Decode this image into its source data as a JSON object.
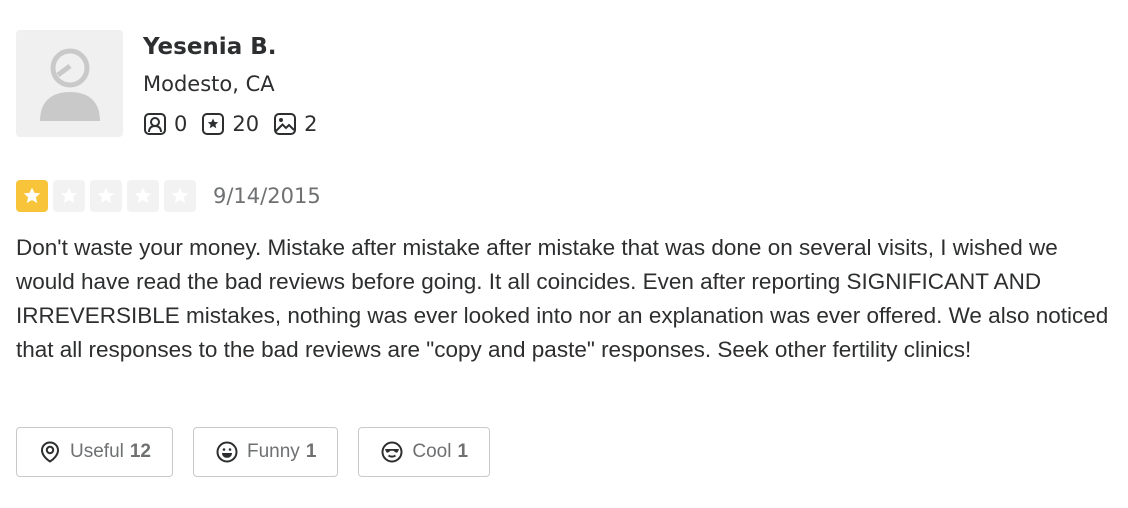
{
  "user": {
    "name": "Yesenia B.",
    "location": "Modesto, CA",
    "stats": {
      "friends": "0",
      "reviews": "20",
      "photos": "2"
    }
  },
  "review": {
    "rating": 1,
    "max_rating": 5,
    "date": "9/14/2015",
    "text": "Don't waste your money. Mistake after mistake after mistake that was done on several visits, I wished we would have read the bad reviews before going. It all coincides. Even after reporting SIGNIFICANT AND IRREVERSIBLE mistakes, nothing was ever looked into nor an explanation was ever offered. We also noticed that all responses to the bad reviews are \"copy and paste\" responses. Seek other fertility clinics!"
  },
  "reactions": {
    "useful": {
      "label": "Useful",
      "count": "12"
    },
    "funny": {
      "label": "Funny",
      "count": "1"
    },
    "cool": {
      "label": "Cool",
      "count": "1"
    }
  },
  "colors": {
    "star_filled": "#f8c53a",
    "star_empty": "#f2f2f2",
    "text": "#2d2e2f",
    "muted": "#6e7072",
    "border": "#c8c9ca"
  },
  "icons": {
    "avatar": "default-user-avatar-icon",
    "friends": "friends-icon",
    "reviews": "review-star-icon",
    "photos": "photo-icon",
    "useful": "useful-icon",
    "funny": "funny-icon",
    "cool": "cool-icon"
  }
}
